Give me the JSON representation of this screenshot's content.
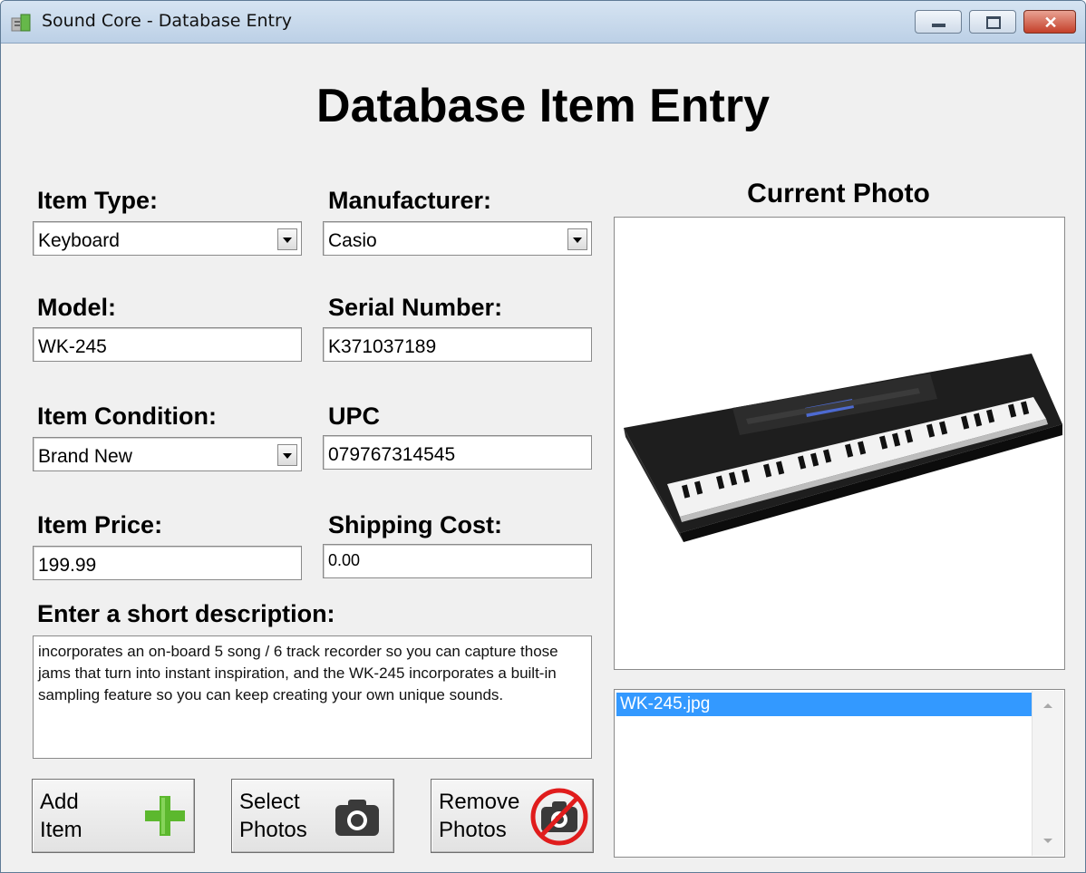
{
  "window": {
    "title": "Sound Core - Database Entry",
    "close_glyph": "✕"
  },
  "heading": "Database Item Entry",
  "form": {
    "item_type": {
      "label": "Item Type:",
      "value": "Keyboard"
    },
    "manufacturer": {
      "label": "Manufacturer:",
      "value": "Casio"
    },
    "model": {
      "label": "Model:",
      "value": "WK-245"
    },
    "serial_number": {
      "label": "Serial Number:",
      "value": "K371037189"
    },
    "item_condition": {
      "label": "Item Condition:",
      "value": "Brand New"
    },
    "upc": {
      "label": "UPC",
      "value": "079767314545"
    },
    "item_price": {
      "label": "Item Price:",
      "value": "199.99"
    },
    "shipping_cost": {
      "label": "Shipping Cost:",
      "value": "0.00"
    },
    "description": {
      "label": "Enter a short description:",
      "value": "incorporates an on-board 5 song / 6 track recorder so you can capture those jams that turn into instant inspiration, and the WK-245 incorporates a built-in sampling feature so you can keep creating your own unique sounds."
    }
  },
  "buttons": {
    "add_item": {
      "line1": "Add",
      "line2": "Item",
      "icon": "plus-icon",
      "icon_color": "#5cb82e"
    },
    "select_photos": {
      "line1": "Select",
      "line2": "Photos",
      "icon": "camera-icon"
    },
    "remove_photos": {
      "line1": "Remove",
      "line2": "Photos",
      "icon": "no-camera-icon",
      "icon_color": "#e01c1c"
    }
  },
  "photo": {
    "title": "Current Photo",
    "image": "casio-wk-245-keyboard"
  },
  "photo_list": {
    "items": [
      "WK-245.jpg"
    ],
    "selected_index": 0,
    "selection_color": "#3399ff"
  }
}
